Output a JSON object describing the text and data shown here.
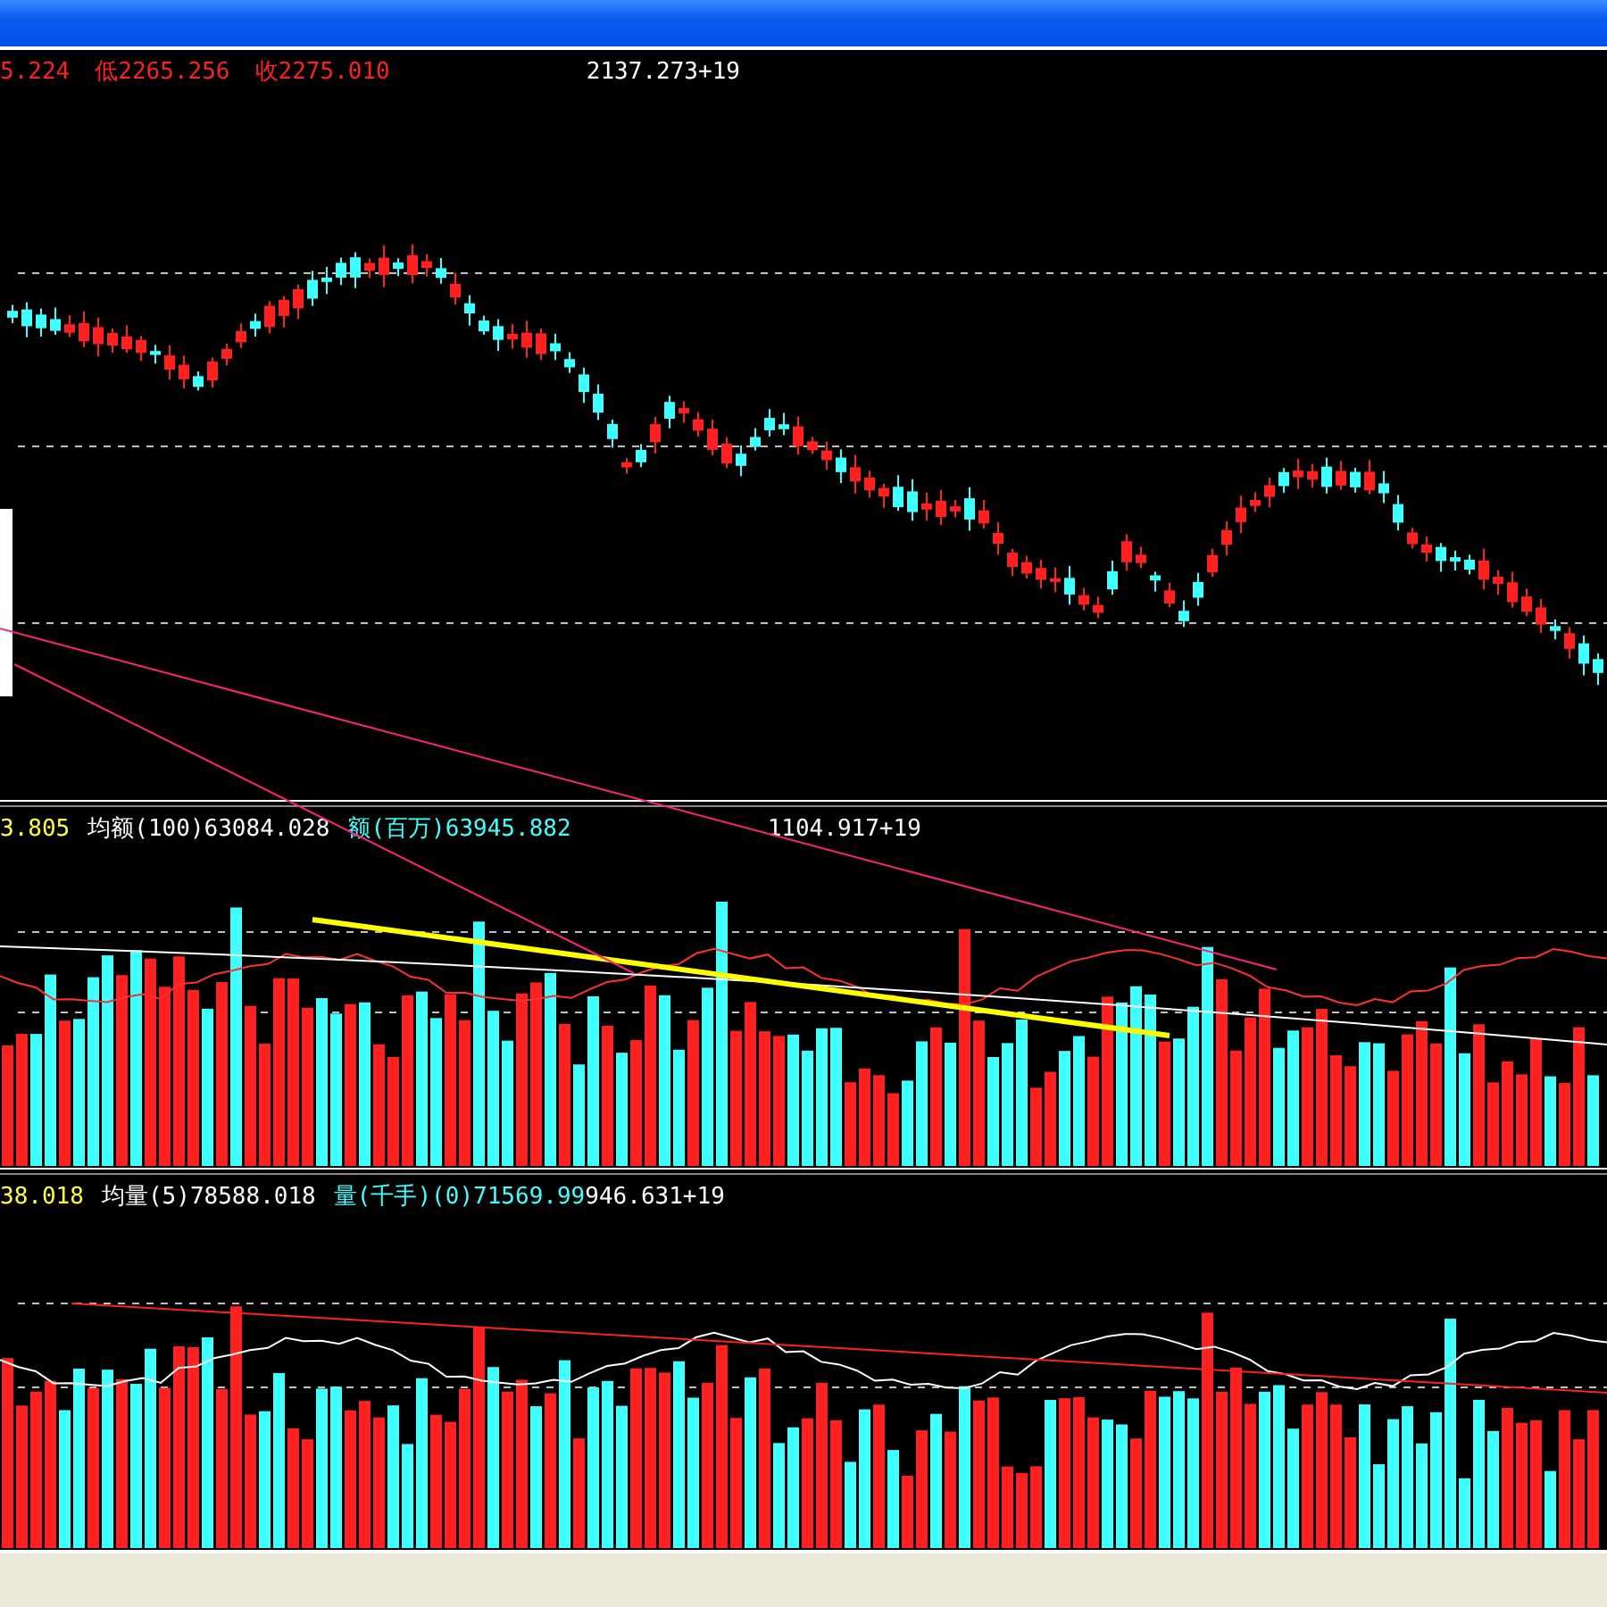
{
  "panels": [
    {
      "kind": "price",
      "header": [
        {
          "kind": "price",
          "text": "5.224"
        },
        {
          "kind": "price",
          "text": "低2265.256"
        },
        {
          "kind": "price",
          "text": "收2275.010"
        },
        {
          "kind": "reading",
          "text": "2137.273+19"
        }
      ]
    },
    {
      "kind": "amount",
      "header": [
        {
          "kind": "indicator",
          "text": "3.805"
        },
        {
          "kind": "average",
          "text": "均额(100)63084.028"
        },
        {
          "kind": "volume",
          "text": "额(百万)63945.882"
        },
        {
          "kind": "reading",
          "text": "1104.917+19"
        }
      ]
    },
    {
      "kind": "volume",
      "header": [
        {
          "kind": "indicator",
          "text": "38.018"
        },
        {
          "kind": "average",
          "text": "均量(5)78588.018"
        },
        {
          "kind": "volume",
          "text": "量(千手)(0)71569.99"
        },
        {
          "kind": "tail",
          "text": "946.631+19"
        }
      ]
    }
  ]
}
